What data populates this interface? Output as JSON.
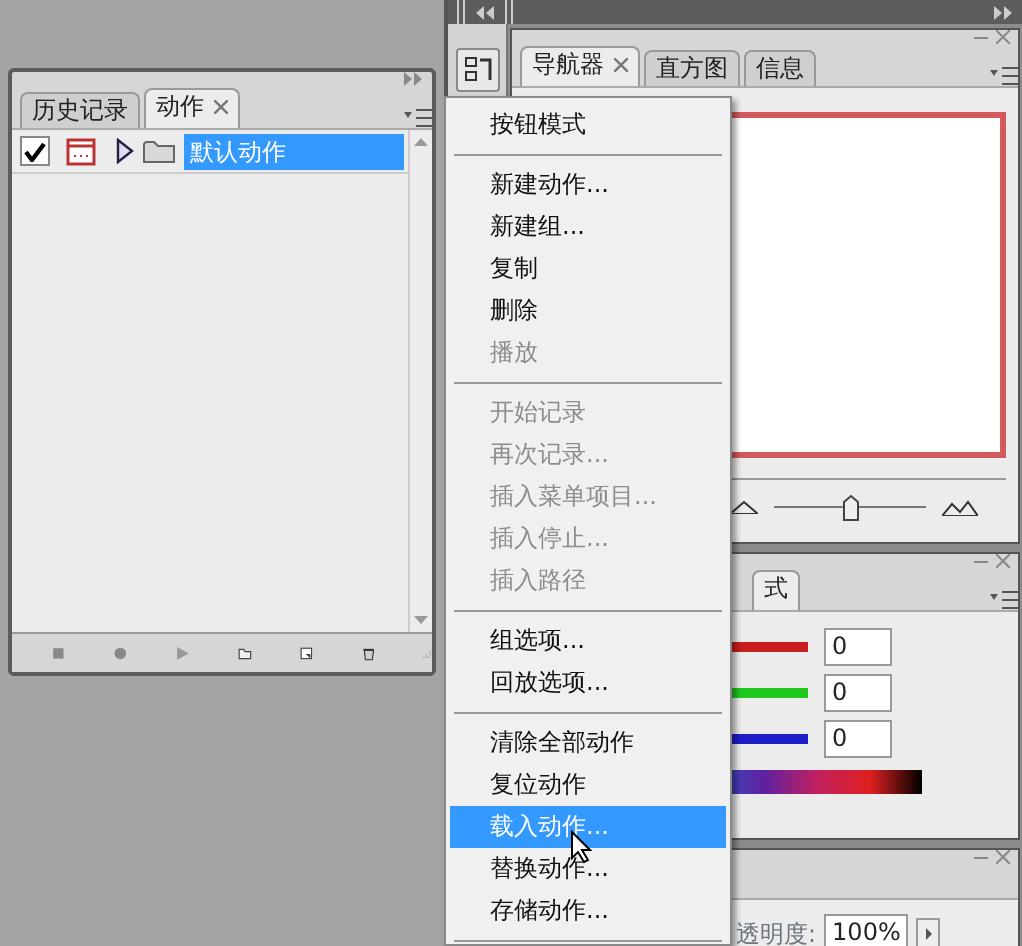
{
  "actions_panel": {
    "tabs": [
      {
        "label": "历史记录",
        "selected": false,
        "closable": false
      },
      {
        "label": "动作",
        "selected": true,
        "closable": true
      }
    ],
    "rows": [
      {
        "label": "默认动作",
        "checked": true,
        "dialog": true,
        "expanded": false,
        "selected": true
      }
    ]
  },
  "navigator_panel": {
    "tabs": [
      {
        "label": "导航器",
        "selected": true,
        "closable": true
      },
      {
        "label": "直方图",
        "selected": false,
        "closable": false
      },
      {
        "label": "信息",
        "selected": false,
        "closable": false
      }
    ],
    "zoom_slider": {
      "level": 0.5
    }
  },
  "color_panel": {
    "tab_fragment": "式",
    "channels": [
      {
        "value": "0",
        "color": "#c81e1e"
      },
      {
        "value": "0",
        "color": "#1ec81e"
      },
      {
        "value": "0",
        "color": "#1e1ec8"
      }
    ]
  },
  "layers_panel": {
    "opacity_label": "透明度:",
    "opacity_value": "100%"
  },
  "menu": {
    "items": [
      {
        "kind": "item",
        "label": "按钮模式",
        "disabled": false,
        "selected": false
      },
      {
        "kind": "separator"
      },
      {
        "kind": "item",
        "label": "新建动作...",
        "disabled": false,
        "selected": false
      },
      {
        "kind": "item",
        "label": "新建组...",
        "disabled": false,
        "selected": false
      },
      {
        "kind": "item",
        "label": "复制",
        "disabled": false,
        "selected": false
      },
      {
        "kind": "item",
        "label": "删除",
        "disabled": false,
        "selected": false
      },
      {
        "kind": "item",
        "label": "播放",
        "disabled": true,
        "selected": false
      },
      {
        "kind": "separator"
      },
      {
        "kind": "item",
        "label": "开始记录",
        "disabled": true,
        "selected": false
      },
      {
        "kind": "item",
        "label": "再次记录...",
        "disabled": true,
        "selected": false
      },
      {
        "kind": "item",
        "label": "插入菜单项目...",
        "disabled": true,
        "selected": false
      },
      {
        "kind": "item",
        "label": "插入停止...",
        "disabled": true,
        "selected": false
      },
      {
        "kind": "item",
        "label": "插入路径",
        "disabled": true,
        "selected": false
      },
      {
        "kind": "separator"
      },
      {
        "kind": "item",
        "label": "组选项...",
        "disabled": false,
        "selected": false
      },
      {
        "kind": "item",
        "label": "回放选项...",
        "disabled": false,
        "selected": false
      },
      {
        "kind": "separator"
      },
      {
        "kind": "item",
        "label": "清除全部动作",
        "disabled": false,
        "selected": false
      },
      {
        "kind": "item",
        "label": "复位动作",
        "disabled": false,
        "selected": false
      },
      {
        "kind": "item",
        "label": "载入动作...",
        "disabled": false,
        "selected": true
      },
      {
        "kind": "item",
        "label": "替换动作...",
        "disabled": false,
        "selected": false
      },
      {
        "kind": "item",
        "label": "存储动作...",
        "disabled": false,
        "selected": false
      },
      {
        "kind": "separator"
      }
    ]
  }
}
